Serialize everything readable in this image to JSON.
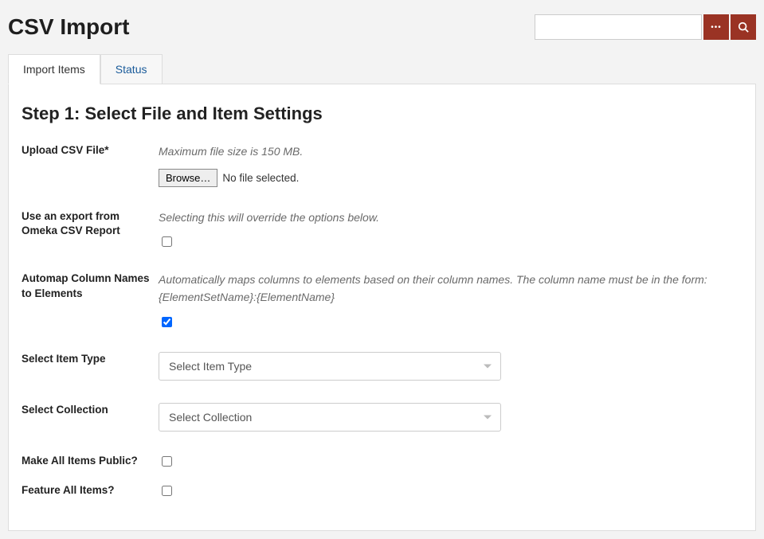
{
  "header": {
    "title": "CSV Import",
    "search_placeholder": ""
  },
  "tabs": {
    "import": "Import Items",
    "status": "Status"
  },
  "form": {
    "step_title": "Step 1: Select File and Item Settings",
    "upload": {
      "label": "Upload CSV File*",
      "hint": "Maximum file size is 150 MB.",
      "button": "Browse…",
      "status": "No file selected."
    },
    "omeka_export": {
      "label": "Use an export from Omeka CSV Report",
      "hint": "Selecting this will override the options below.",
      "checked": false
    },
    "automap": {
      "label": "Automap Column Names to Elements",
      "hint": "Automatically maps columns to elements based on their column names. The column name must be in the form: {ElementSetName}:{ElementName}",
      "checked": true
    },
    "item_type": {
      "label": "Select Item Type",
      "placeholder": "Select Item Type"
    },
    "collection": {
      "label": "Select Collection",
      "placeholder": "Select Collection"
    },
    "make_public": {
      "label": "Make All Items Public?",
      "checked": false
    },
    "feature_all": {
      "label": "Feature All Items?",
      "checked": false
    }
  }
}
